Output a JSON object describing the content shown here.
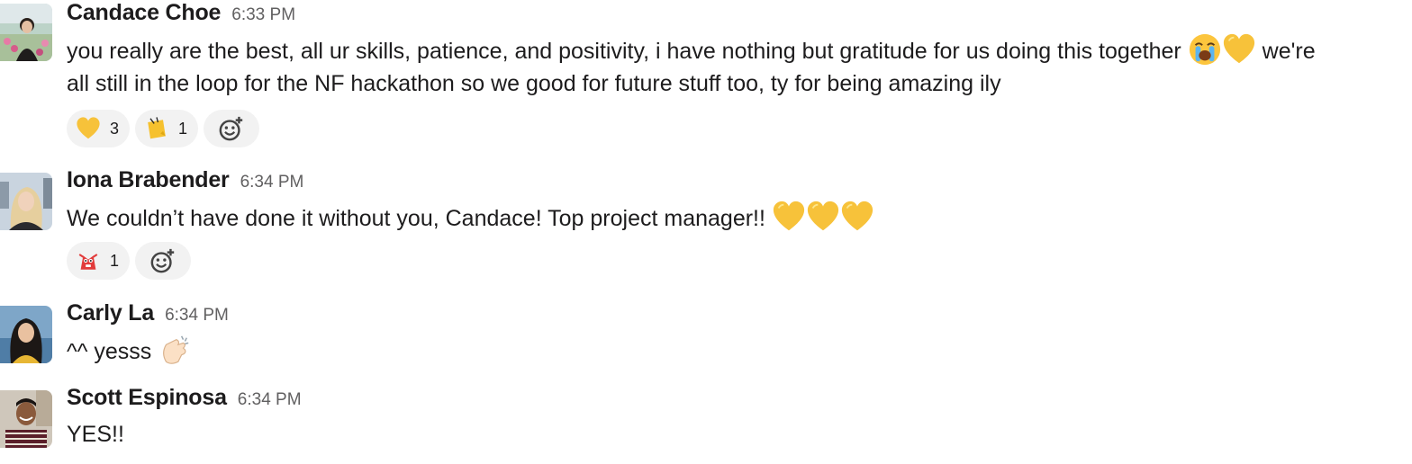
{
  "messages": [
    {
      "author": "Candace Choe",
      "time": "6:33 PM",
      "line1": "you really are the best, all ur skills, patience, and positivity, i have nothing but gratitude for us doing this together",
      "line1_tail": "we're",
      "line2": "all still in the loop for the NF hackathon so we good for future stuff too, ty for being amazing ily",
      "inline_emojis": [
        "loudly-crying-face",
        "yellow-heart"
      ],
      "reactions": [
        {
          "emoji": "yellow-heart",
          "count": "3"
        },
        {
          "emoji": "sticky-note-custom",
          "count": "1"
        }
      ]
    },
    {
      "author": "Iona Brabender",
      "time": "6:34 PM",
      "text": "We couldn’t have done it without you, Candace! Top project manager!!",
      "inline_emojis": [
        "yellow-heart",
        "yellow-heart",
        "yellow-heart"
      ],
      "reactions": [
        {
          "emoji": "party-parrot-custom",
          "count": "1"
        }
      ]
    },
    {
      "author": "Carly La",
      "time": "6:34 PM",
      "text": "^^ yesss",
      "inline_emojis": [
        "clapping-hands"
      ]
    },
    {
      "author": "Scott Espinosa",
      "time": "6:34 PM",
      "text": "YES!!"
    }
  ],
  "colors": {
    "author": "#1d1c1d",
    "timestamp": "#616061",
    "reaction_bg": "#f2f2f2",
    "heart": "#f7c23a"
  }
}
